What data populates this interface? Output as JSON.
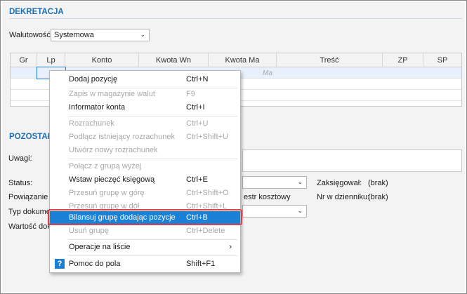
{
  "section_dekretacja": "DEKRETACJA",
  "currency": {
    "label": "Walutowość:",
    "value": "Systemowa"
  },
  "grid": {
    "columns": [
      "Gr",
      "Lp",
      "Konto",
      "Kwota Wn",
      "Kwota Ma",
      "Treść",
      "ZP",
      "SP"
    ],
    "ghost_value": "Ma"
  },
  "section_pozostale": "POZOSTAŁ",
  "fields": {
    "uwagi": "Uwagi:",
    "status": "Status:",
    "powiazanie": "Powiązanie V",
    "typ_dokumentu": "Typ dokumen",
    "wartosc": "Wartość doku",
    "rejestr": "estr kosztowy",
    "zaksiegowal_label": "Zaksięgował:",
    "zaksiegowal_value": "(brak)",
    "nr_dziennik_label": "Nr w dzienniku:",
    "nr_dziennik_value": "(brak)"
  },
  "menu": {
    "items": [
      {
        "label": "Dodaj pozycję",
        "shortcut": "Ctrl+N",
        "enabled": true
      },
      {
        "label": "Zapis w magazynie walut",
        "shortcut": "F9",
        "enabled": false
      },
      {
        "label": "Informator konta",
        "shortcut": "Ctrl+I",
        "enabled": true
      },
      {
        "label": "Rozrachunek",
        "shortcut": "Ctrl+U",
        "enabled": false
      },
      {
        "label": "Podłącz istniejący rozrachunek",
        "shortcut": "Ctrl+Shift+U",
        "enabled": false
      },
      {
        "label": "Utwórz nowy rozrachunek",
        "shortcut": "",
        "enabled": false
      },
      {
        "label": "Połącz z grupą wyżej",
        "shortcut": "",
        "enabled": false
      },
      {
        "label": "Wstaw pieczęć księgową",
        "shortcut": "Ctrl+E",
        "enabled": true
      },
      {
        "label": "Przesuń grupę w górę",
        "shortcut": "Ctrl+Shift+O",
        "enabled": false
      },
      {
        "label": "Przesuń grupę w dół",
        "shortcut": "Ctrl+Shift+L",
        "enabled": false
      },
      {
        "label": "Bilansuj grupę dodając pozycje",
        "shortcut": "Ctrl+B",
        "enabled": true,
        "highlighted": true
      },
      {
        "label": "Usuń grupę",
        "shortcut": "Ctrl+Delete",
        "enabled": false
      },
      {
        "label": "Operacje na liście",
        "shortcut": "",
        "enabled": true,
        "submenu_arrow": "›"
      },
      {
        "label": "Pomoc do pola",
        "shortcut": "Shift+F1",
        "enabled": true,
        "icon": "help-icon",
        "icon_glyph": "?"
      }
    ]
  },
  "colors": {
    "accent": "#1e6fb4",
    "highlight": "#1a81d6",
    "outline": "#d9414e"
  }
}
